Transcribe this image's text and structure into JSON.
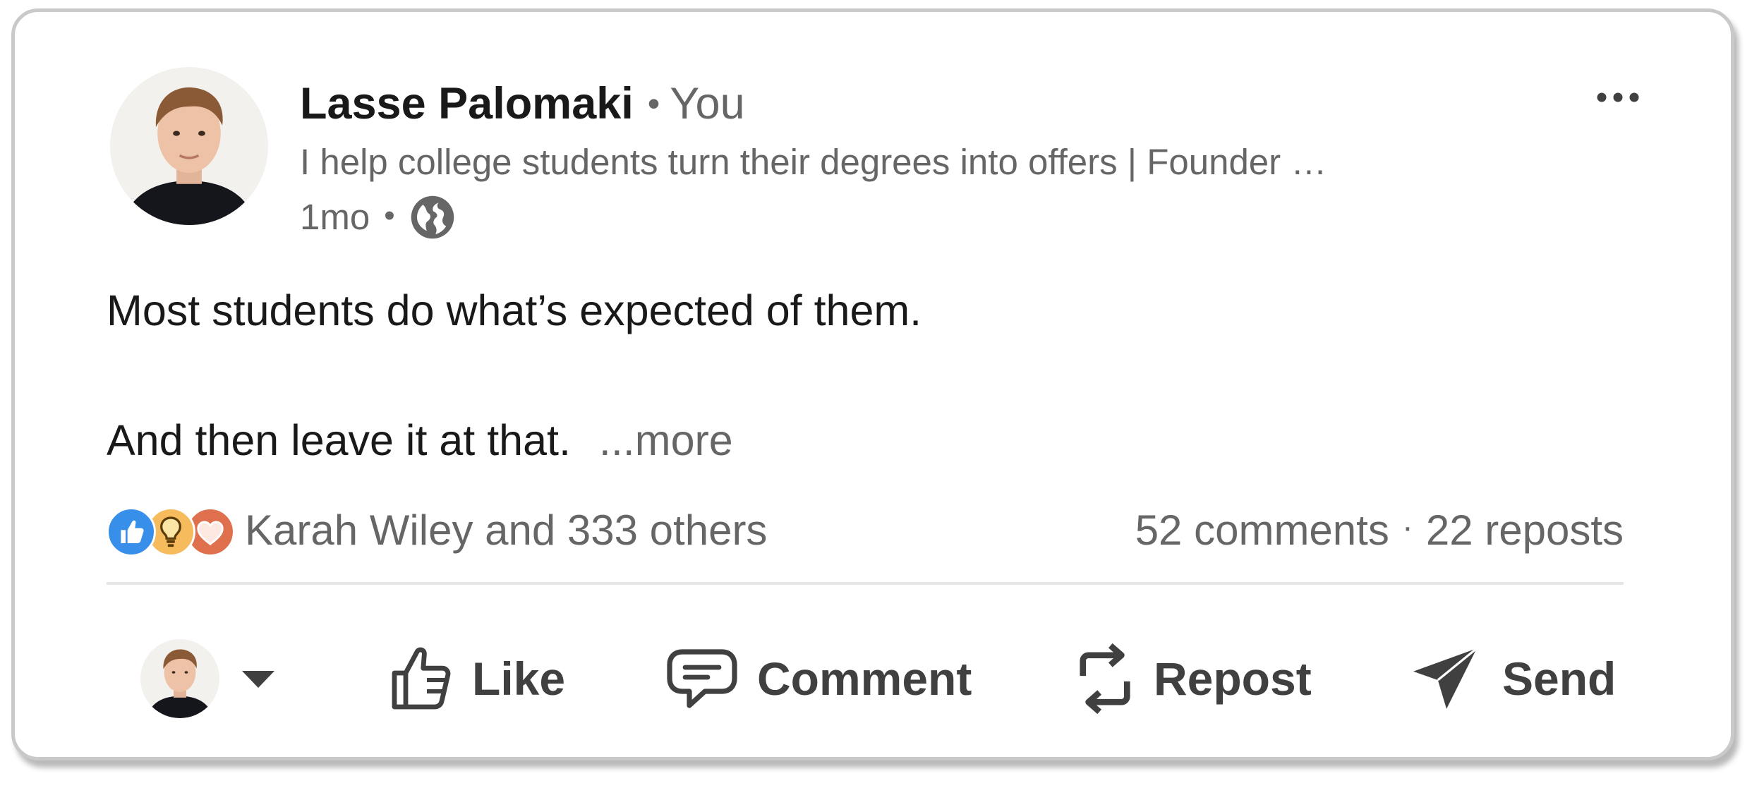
{
  "post": {
    "author_name": "Lasse Palomaki",
    "connection_dot": "•",
    "connection_label": "You",
    "headline": "I help college students turn their degrees into offers | Founder …",
    "timestamp": "1mo",
    "meta_dot": "•",
    "visibility_icon": "globe-icon",
    "body_line_1": "Most students do what’s expected of them.",
    "body_line_2": "And then leave it at that.",
    "more_label": "...more"
  },
  "social": {
    "reaction_icons": [
      "like-reaction-icon",
      "insightful-reaction-icon",
      "love-reaction-icon"
    ],
    "reactions_label": "Karah Wiley and 333 others",
    "comments_label": "52 comments",
    "separator": "·",
    "reposts_label": "22 reposts"
  },
  "actions": {
    "like": "Like",
    "comment": "Comment",
    "repost": "Repost",
    "send": "Send"
  },
  "colors": {
    "like_blue": "#378fe9",
    "insightful_yellow": "#f5bb5c",
    "love_red": "#df704d",
    "text_primary": "#191919",
    "text_secondary": "#666666",
    "action_gray": "#404040"
  }
}
